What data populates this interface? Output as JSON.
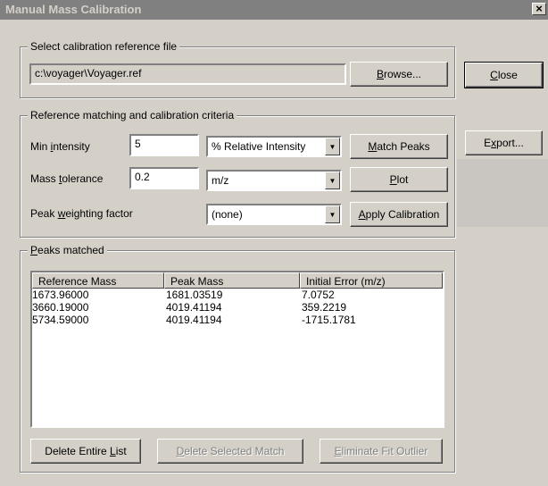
{
  "window": {
    "title": "Manual Mass Calibration",
    "close_glyph": "×"
  },
  "ref_file": {
    "group_label": "Select calibration reference file",
    "path": "c:\\voyager\\Voyager.ref",
    "browse_pre": "",
    "browse_u": "B",
    "browse_post": "rowse..."
  },
  "side_buttons": {
    "close_u": "C",
    "close_post": "lose",
    "export_pre": "E",
    "export_u": "x",
    "export_post": "port..."
  },
  "criteria": {
    "group_label": "Reference matching and calibration criteria",
    "min_intensity_pre": "Min ",
    "min_intensity_u": "i",
    "min_intensity_post": "ntensity",
    "min_intensity_value": "5",
    "intensity_mode": "% Relative Intensity",
    "mass_tol_pre": "Mass ",
    "mass_tol_u": "t",
    "mass_tol_post": "olerance",
    "mass_tol_value": "0.2",
    "mass_tol_unit": "m/z",
    "weight_pre": "Peak ",
    "weight_u": "w",
    "weight_post": "eighting factor",
    "weight_value": "(none)",
    "match_u": "M",
    "match_post": "atch Peaks",
    "plot_u": "P",
    "plot_post": "lot",
    "apply_u": "A",
    "apply_post": "pply Calibration"
  },
  "peaks": {
    "group_u": "P",
    "group_post": "eaks matched",
    "columns": [
      "Reference Mass",
      "Peak Mass",
      "Initial Error (m/z)"
    ],
    "rows": [
      [
        "1673.96000",
        "1681.03519",
        "7.0752"
      ],
      [
        "3660.19000",
        "4019.41194",
        "359.2219"
      ],
      [
        "5734.59000",
        "4019.41194",
        "-1715.1781"
      ]
    ],
    "delete_all_pre": "Delete Entire ",
    "delete_all_u": "L",
    "delete_all_post": "ist",
    "delete_sel_u": "D",
    "delete_sel_post": "elete Selected Match",
    "eliminate_u": "E",
    "eliminate_post": "liminate Fit Outlier"
  },
  "icons": {
    "dropdown_arrow": "▼"
  }
}
